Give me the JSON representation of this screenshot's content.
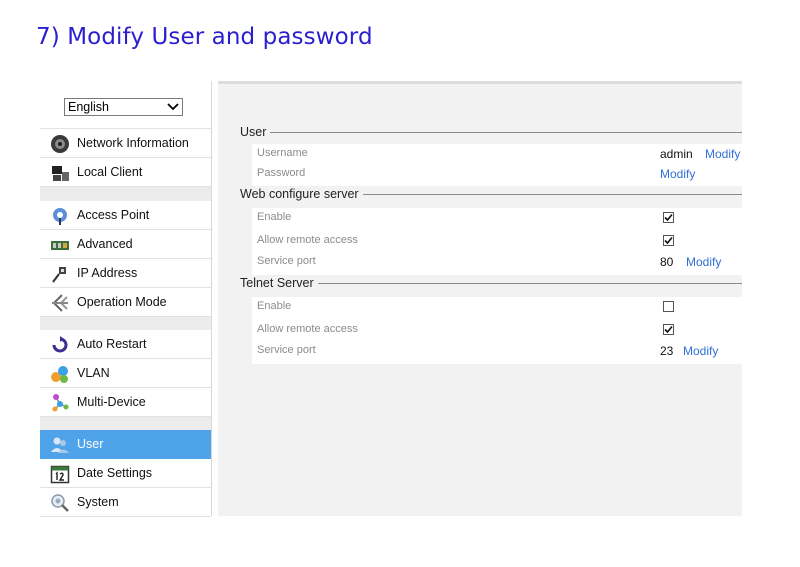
{
  "heading": "7) Modify User and password",
  "language": {
    "selected": "English"
  },
  "nav": [
    {
      "label": "Network Information",
      "icon": "network-info-icon"
    },
    {
      "label": "Local Client",
      "icon": "local-client-icon"
    },
    {
      "label": "Access Point",
      "icon": "access-point-icon"
    },
    {
      "label": "Advanced",
      "icon": "advanced-icon"
    },
    {
      "label": "IP Address",
      "icon": "ip-address-icon"
    },
    {
      "label": "Operation Mode",
      "icon": "operation-mode-icon"
    },
    {
      "label": "Auto Restart",
      "icon": "auto-restart-icon"
    },
    {
      "label": "VLAN",
      "icon": "vlan-icon"
    },
    {
      "label": "Multi-Device",
      "icon": "multi-device-icon"
    },
    {
      "label": "User",
      "icon": "user-icon",
      "active": true
    },
    {
      "label": "Date Settings",
      "icon": "calendar-icon"
    },
    {
      "label": "System",
      "icon": "system-icon"
    }
  ],
  "colors": {
    "heading": "#2b1ed0",
    "active": "#4fa3e8",
    "link": "#2f6fd6"
  },
  "user_section": {
    "title": "User",
    "username_label": "Username",
    "username_value": "admin",
    "username_modify": "Modify",
    "password_label": "Password",
    "password_modify": "Modify"
  },
  "web_section": {
    "title": "Web configure server",
    "enable_label": "Enable",
    "enable_checked": true,
    "remote_label": "Allow remote access",
    "remote_checked": true,
    "port_label": "Service port",
    "port_value": "80",
    "port_modify": "Modify"
  },
  "telnet_section": {
    "title": "Telnet Server",
    "enable_label": "Enable",
    "enable_checked": false,
    "remote_label": "Allow remote access",
    "remote_checked": true,
    "port_label": "Service port",
    "port_value": "23",
    "port_modify": "Modify"
  }
}
